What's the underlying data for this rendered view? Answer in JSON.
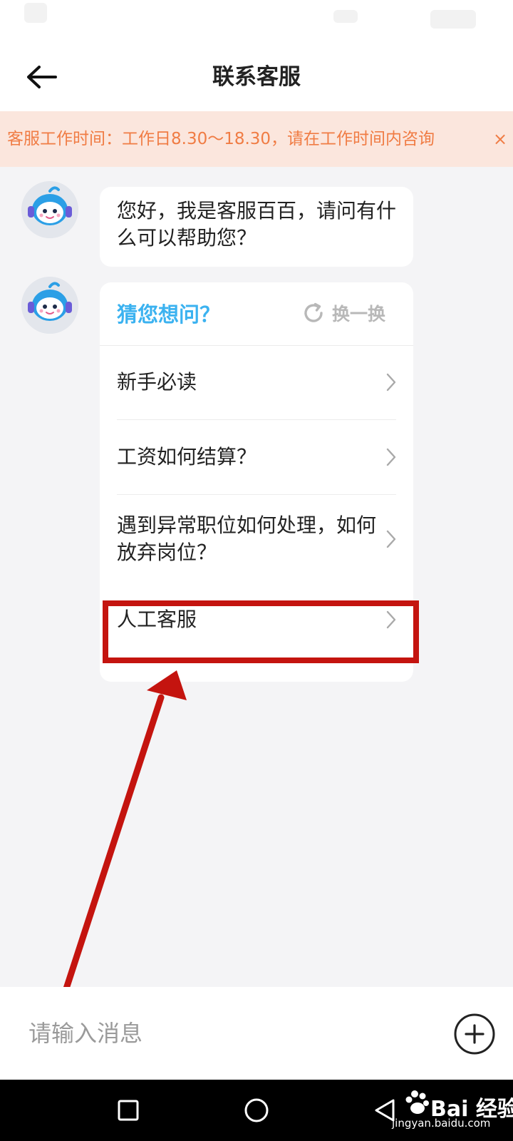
{
  "header": {
    "title": "联系客服",
    "back_icon": "arrow-left-icon"
  },
  "notice": {
    "text": "客服工作时间：工作日8.30～18.30，请在工作时间内咨询",
    "close": "×"
  },
  "chat": {
    "greeting": "您好，我是客服百百，请问有什么可以帮助您？",
    "avatar_icon": "robot-avatar-icon",
    "faq": {
      "title": "猜您想问？",
      "refresh_label": "换一换",
      "items": [
        {
          "label": "新手必读"
        },
        {
          "label": "工资如何结算？"
        },
        {
          "label": "遇到异常职位如何处理，如何放弃岗位？"
        },
        {
          "label": "人工客服"
        }
      ]
    }
  },
  "input": {
    "placeholder": "请输入消息",
    "plus_icon": "plus-circle-icon"
  },
  "watermark": {
    "brand": "Bai 经验",
    "url": "jingyan.baidu.com"
  },
  "colors": {
    "accent": "#3bb2f0",
    "notice_text": "#f07c44",
    "notice_bg": "#fbe6dd",
    "highlight": "#c4140f"
  }
}
